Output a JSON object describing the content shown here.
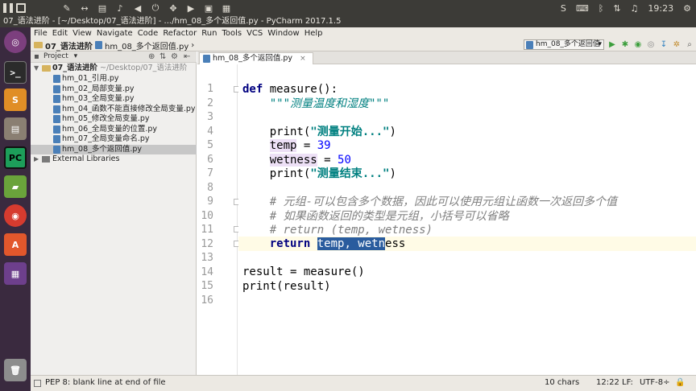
{
  "os_panel": {
    "icons": [
      "wrench-icon",
      "arrows-icon",
      "pdf-icon",
      "bell-icon",
      "sound-icon",
      "power-icon",
      "move-icon",
      "play-icon",
      "save-icon",
      "clipboard-icon"
    ],
    "tray": {
      "clock": "19:23"
    }
  },
  "window": {
    "title": "07_语法进阶 - [~/Desktop/07_语法进阶] - .../hm_08_多个返回值.py - PyCharm 2017.1.5"
  },
  "menu": {
    "items": [
      "File",
      "Edit",
      "View",
      "Navigate",
      "Code",
      "Refactor",
      "Run",
      "Tools",
      "VCS",
      "Window",
      "Help"
    ]
  },
  "navbar": {
    "crumbs": [
      "07_语法进阶",
      "hm_08_多个返回值.py"
    ],
    "run_config": "hm_08_多个返回值"
  },
  "project": {
    "header": "Project",
    "root": {
      "name": "07_语法进阶",
      "path": "~/Desktop/07_语法进阶"
    },
    "files": [
      "hm_01_引用.py",
      "hm_02_局部变量.py",
      "hm_03_全局变量.py",
      "hm_04_函数不能直接修改全局变量.py",
      "hm_05_修改全局变量.py",
      "hm_06_全局变量的位置.py",
      "hm_07_全局变量命名.py",
      "hm_08_多个返回值.py"
    ],
    "selected_index": 7,
    "external": "External Libraries"
  },
  "editor": {
    "tab": "hm_08_多个返回值.py",
    "line_numbers": [
      "1",
      "2",
      "3",
      "4",
      "5",
      "6",
      "7",
      "8",
      "9",
      "10",
      "11",
      "12",
      "13",
      "14",
      "15",
      "16"
    ],
    "lines": {
      "l1_def": "def",
      "l1_rest": " measure():",
      "l2": "    \"\"\"测量温度和湿度\"\"\"",
      "l4_fn": "    print(",
      "l4_str": "\"测量开始...\"",
      "l4_end": ")",
      "l5_var": "temp",
      "l5_op": " = ",
      "l5_num": "39",
      "l6_var": "wetness",
      "l6_op": " = ",
      "l6_num": "50",
      "l7_fn": "    print(",
      "l7_str": "\"测量结束...\"",
      "l7_end": ")",
      "l9": "    # 元组-可以包含多个数据，因此可以使用元组让函数一次返回多个值",
      "l10": "    # 如果函数返回的类型是元组，小括号可以省略",
      "l11": "    # return (temp, wetness)",
      "l12_kw": "return",
      "l12_sel": "temp, wetn",
      "l12_rest": "ess",
      "l14": "result = measure()",
      "l15": "print(result)"
    }
  },
  "status": {
    "message": "PEP 8: blank line at end of file",
    "chars": "10 chars",
    "position": "12:22",
    "line_sep": "LF:",
    "encoding": "UTF-8÷"
  }
}
